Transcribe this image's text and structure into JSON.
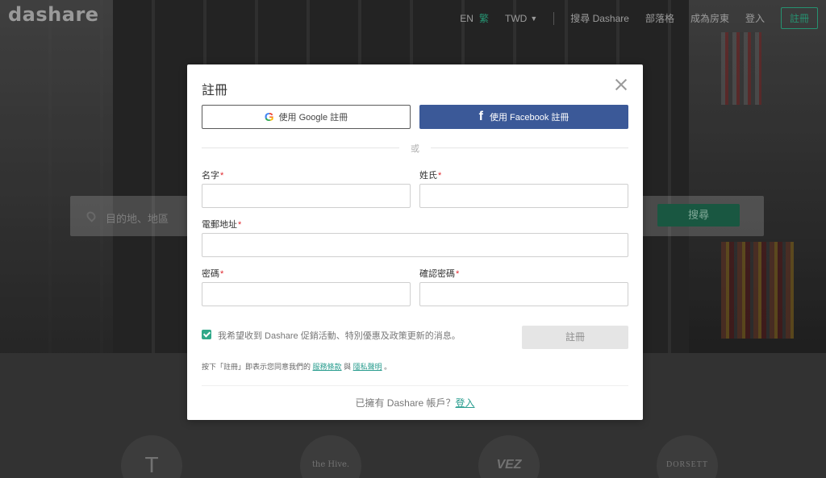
{
  "background": {
    "logo": "dashare",
    "nav": {
      "lang_en": "EN",
      "lang_zh": "繁",
      "currency": "TWD",
      "links": [
        "搜尋 Dashare",
        "部落格",
        "成為房東",
        "登入"
      ],
      "signup": "註冊"
    },
    "search": {
      "placeholder": "目的地、地區",
      "button": "搜尋"
    },
    "brands": [
      "T",
      "the Hive.",
      "VEZ",
      "DORSETT"
    ]
  },
  "modal": {
    "title": "註冊",
    "google_button": "使用 Google 註冊",
    "google_icon_glyph": "G",
    "facebook_button": "使用 Facebook 註冊",
    "facebook_icon_glyph": "f",
    "divider_text": "或",
    "fields": {
      "first_name": "名字",
      "last_name": "姓氏",
      "email": "電郵地址",
      "password": "密碼",
      "confirm_password": "確認密碼",
      "required_mark": "*"
    },
    "newsletter_text": "我希望收到 Dashare 促銷活動、特別優惠及政策更新的消息。",
    "submit_button": "註冊",
    "terms": {
      "prefix": "按下「註冊」即表示您同意我們的",
      "service_link": "服務條款",
      "and": "與",
      "privacy_link": "隱私聲明",
      "suffix": "。"
    },
    "login_prompt": "已擁有 Dashare 帳戶？",
    "login_link": "登入"
  },
  "colors": {
    "accent": "#2fa889",
    "facebook": "#3b5998",
    "required": "#e0292f"
  }
}
